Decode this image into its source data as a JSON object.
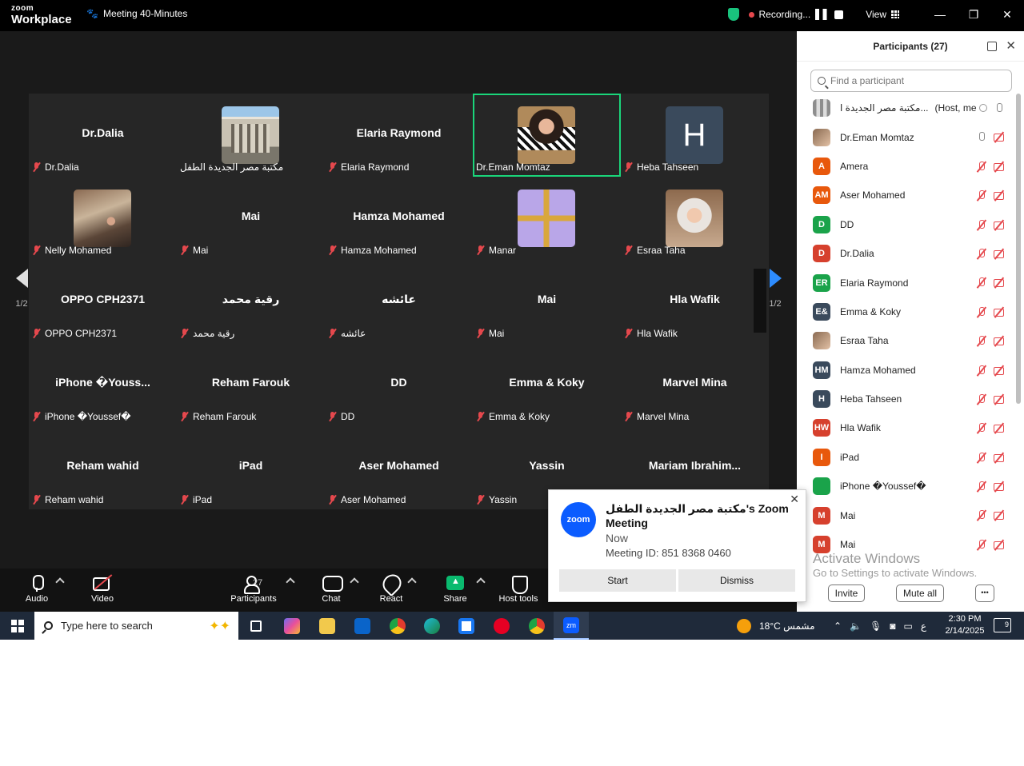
{
  "titlebar": {
    "logo_top": "zoom",
    "logo_bottom": "Workplace",
    "meeting_title": "Meeting 40-Minutes",
    "recording_label": "Recording...",
    "view_label": "View",
    "minimize": "—",
    "maximize": "❐",
    "close": "✕"
  },
  "tiles": [
    {
      "name": "Dr.Dalia",
      "label": "Dr.Dalia",
      "muted": true,
      "pic": ""
    },
    {
      "name": "",
      "label": "مكتبة مصر الجديدة الطفل",
      "muted": false,
      "pic": "library"
    },
    {
      "name": "Elaria Raymond",
      "label": "Elaria Raymond",
      "muted": true,
      "pic": ""
    },
    {
      "name": "",
      "label": "Dr.Eman Momtaz",
      "muted": false,
      "pic": "eman",
      "active": true
    },
    {
      "name": "",
      "label": "Heba Tahseen",
      "muted": true,
      "pic": "H"
    },
    {
      "name": "",
      "label": "Nelly Mohamed",
      "muted": true,
      "pic": "nelly"
    },
    {
      "name": "Mai",
      "label": "Mai",
      "muted": true,
      "pic": ""
    },
    {
      "name": "Hamza Mohamed",
      "label": "Hamza Mohamed",
      "muted": true,
      "pic": ""
    },
    {
      "name": "",
      "label": "Manar",
      "muted": true,
      "pic": "gift"
    },
    {
      "name": "",
      "label": "Esraa Taha",
      "muted": true,
      "pic": "esraa"
    },
    {
      "name": "OPPO CPH2371",
      "label": "OPPO CPH2371",
      "muted": true,
      "pic": ""
    },
    {
      "name": "رقية محمد",
      "label": "رقية محمد",
      "muted": true,
      "pic": ""
    },
    {
      "name": "عائشه",
      "label": "عائشه",
      "muted": true,
      "pic": ""
    },
    {
      "name": "Mai",
      "label": "Mai",
      "muted": true,
      "pic": ""
    },
    {
      "name": "Hla Wafik",
      "label": "Hla Wafik",
      "muted": true,
      "pic": ""
    },
    {
      "name": "iPhone �Youss...",
      "label": "iPhone �Youssef�",
      "muted": true,
      "pic": ""
    },
    {
      "name": "Reham Farouk",
      "label": "Reham Farouk",
      "muted": true,
      "pic": ""
    },
    {
      "name": "DD",
      "label": "DD",
      "muted": true,
      "pic": ""
    },
    {
      "name": "Emma & Koky",
      "label": "Emma & Koky",
      "muted": true,
      "pic": ""
    },
    {
      "name": "Marvel Mina",
      "label": "Marvel Mina",
      "muted": true,
      "pic": ""
    },
    {
      "name": "Reham wahid",
      "label": "Reham wahid",
      "muted": true,
      "pic": ""
    },
    {
      "name": "iPad",
      "label": "iPad",
      "muted": true,
      "pic": ""
    },
    {
      "name": "Aser Mohamed",
      "label": "Aser Mohamed",
      "muted": true,
      "pic": ""
    },
    {
      "name": "Yassin",
      "label": "Yassin",
      "muted": true,
      "pic": ""
    },
    {
      "name": "Mariam  Ibrahim...",
      "label": "",
      "muted": true,
      "pic": ""
    }
  ],
  "pager": {
    "left_page": "1/2",
    "right_page": "1/2"
  },
  "toolbar": {
    "audio": "Audio",
    "video": "Video",
    "participants": "Participants",
    "participants_count": "27",
    "chat": "Chat",
    "react": "React",
    "share": "Share",
    "host_tools": "Host tools"
  },
  "panel": {
    "title": "Participants (27)",
    "search_placeholder": "Find a participant",
    "participants": [
      {
        "name": "مكتبة مصر الجديدة ا...",
        "tag": "(Host, me)",
        "avatar": "",
        "color": "#8e8e8e",
        "kind": "host"
      },
      {
        "name": "Dr.Eman Momtaz",
        "avatar": "",
        "color": "#a77b5a",
        "kind": "img"
      },
      {
        "name": "Amera",
        "avatar": "A",
        "color": "#e8580c"
      },
      {
        "name": "Aser Mohamed",
        "avatar": "AM",
        "color": "#e8580c"
      },
      {
        "name": "DD",
        "avatar": "D",
        "color": "#1aa34a"
      },
      {
        "name": "Dr.Dalia",
        "avatar": "D",
        "color": "#d6402d"
      },
      {
        "name": "Elaria Raymond",
        "avatar": "ER",
        "color": "#1aa34a"
      },
      {
        "name": "Emma & Koky",
        "avatar": "E&",
        "color": "#3a4a5c"
      },
      {
        "name": "Esraa Taha",
        "avatar": "",
        "color": "#c9a98e",
        "kind": "img"
      },
      {
        "name": "Hamza Mohamed",
        "avatar": "HM",
        "color": "#3a4a5c"
      },
      {
        "name": "Heba Tahseen",
        "avatar": "H",
        "color": "#3a4a5c"
      },
      {
        "name": "Hla Wafik",
        "avatar": "HW",
        "color": "#d6402d"
      },
      {
        "name": "iPad",
        "avatar": "I",
        "color": "#e8580c"
      },
      {
        "name": "iPhone �Youssef�",
        "avatar": "",
        "color": "#1aa34a"
      },
      {
        "name": "Mai",
        "avatar": "M",
        "color": "#d6402d"
      },
      {
        "name": "Mai",
        "avatar": "M",
        "color": "#d6402d"
      }
    ],
    "activate_line1": "Activate Windows",
    "activate_line2": "Go to Settings to activate Windows.",
    "invite": "Invite",
    "mute_all": "Mute all",
    "more": "•••"
  },
  "notification": {
    "logo": "zoom",
    "title": "مكتبة مصر الجديدة الطفل's Zoom Meeting",
    "time": "Now",
    "meeting_id": "Meeting ID: 851 8368 0460",
    "start": "Start",
    "dismiss": "Dismiss"
  },
  "taskbar": {
    "search_placeholder": "Type here to search",
    "weather": "18°C  مشمس",
    "lang": "ع",
    "time": "2:30 PM",
    "date": "2/14/2025",
    "notif_count": "9"
  }
}
